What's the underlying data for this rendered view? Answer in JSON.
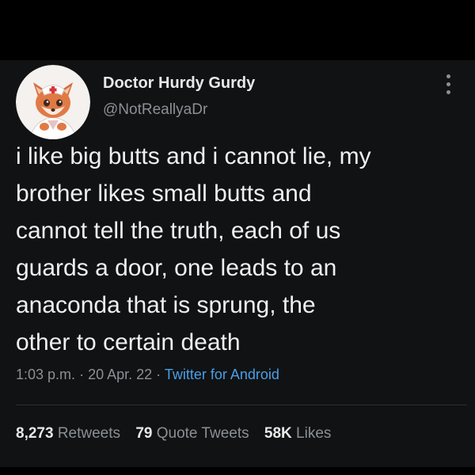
{
  "author": {
    "display_name": "Doctor Hurdy Gurdy",
    "handle": "@NotReallyaDr",
    "avatar_icon": "fox-doctor-avatar-icon"
  },
  "tweet": {
    "lines": [
      "i like big butts and i cannot lie, my",
      "brother likes small butts and",
      "cannot tell the truth, each of us",
      "guards a door, one leads to an",
      "anaconda that is sprung, the",
      "other to certain death"
    ],
    "time": "1:03 p.m.",
    "date": "20 Apr. 22",
    "separator": "·",
    "source": "Twitter for Android"
  },
  "stats": {
    "retweets_count": "8,273",
    "retweets_label": "Retweets",
    "quote_count": "79",
    "quote_label": "Quote Tweets",
    "likes_count": "58K",
    "likes_label": "Likes"
  },
  "colors": {
    "background": "#000000",
    "card": "#111213",
    "text": "#f0f0f0",
    "secondary": "#8a9096",
    "link": "#4a9fe6"
  },
  "icons": {
    "more": "more-vertical-icon"
  }
}
